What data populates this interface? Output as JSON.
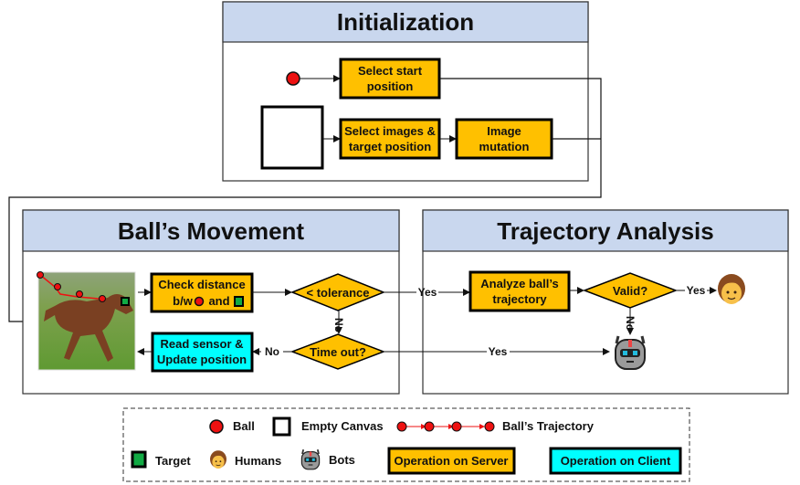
{
  "colors": {
    "server": "#ffc000",
    "client": "#00ffff",
    "header": "#c9d7ee",
    "ball": "#ee1111",
    "target": "#119944"
  },
  "panels": {
    "init": "Initialization",
    "movement": "Ball’s Movement",
    "analysis": "Trajectory Analysis"
  },
  "init": {
    "start_1": "Select start",
    "start_2": "position",
    "images_1": "Select images &",
    "images_2": "target position",
    "mut_1": "Image",
    "mut_2": "mutation"
  },
  "movement": {
    "check_1": "Check distance",
    "check_2a": "b/w",
    "check_2b": "and",
    "tolerance": "< tolerance",
    "timeout": "Time out?",
    "read_1": "Read sensor &",
    "read_2": "Update position",
    "no1": "No",
    "no2": "No",
    "yes1": "Yes",
    "yes2": "Yes"
  },
  "analysis": {
    "analyze_1": "Analyze ball’s",
    "analyze_2": "trajectory",
    "valid": "Valid?",
    "yes": "Yes",
    "no": "No",
    "human_icon": "human-icon",
    "bot_icon": "bot-icon"
  },
  "legend": {
    "ball": "Ball",
    "canvas": "Empty Canvas",
    "trajectory": "Ball’s Trajectory",
    "target": "Target",
    "humans": "Humans",
    "bots": "Bots",
    "server": "Operation on Server",
    "client": "Operation on Client"
  }
}
